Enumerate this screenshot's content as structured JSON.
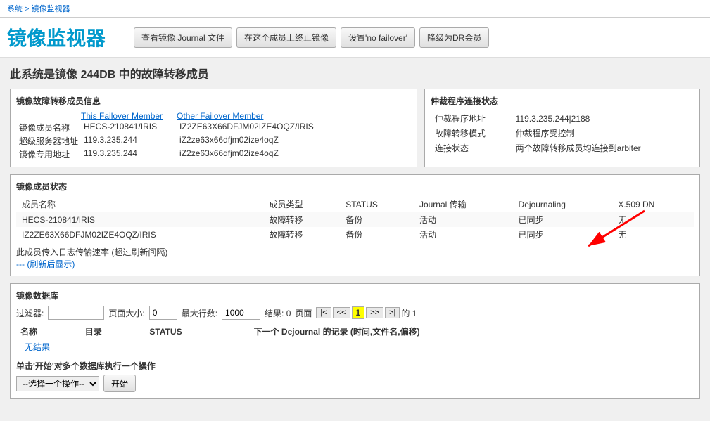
{
  "breadcrumb": {
    "system": "系统",
    "separator": " > ",
    "current": "镜像监视器"
  },
  "header": {
    "title": "镜像监视器",
    "buttons": {
      "view_journal": "查看镜像 Journal 文件",
      "stop_mirror": "在这个成员上终止镜像",
      "no_failover": "设置'no failover'",
      "dr_member": "降级为DR会员"
    }
  },
  "page_title": "此系统是镜像 244DB 中的故障转移成员",
  "failover_section": {
    "title": "镜像故障转移成员信息",
    "col_this": "This Failover Member",
    "col_other": "Other Failover Member",
    "rows": [
      {
        "label": "镜像成员名称",
        "this_value": "HECS-210841/IRIS",
        "other_value": "IZ2ZE63X66DFJM02IZE4OQZ/IRIS"
      },
      {
        "label": "超级服务器地址",
        "this_value": "119.3.235.244",
        "other_value": "iZ2ze63x66dfjm02ize4oqZ"
      },
      {
        "label": "镜像专用地址",
        "this_value": "119.3.235.244",
        "other_value": "iZ2ze63x66dfjm02ize4oqZ"
      }
    ]
  },
  "arbiter_section": {
    "title": "仲裁程序连接状态",
    "rows": [
      {
        "label": "仲裁程序地址",
        "value": "119.3.235.244|2188"
      },
      {
        "label": "故障转移模式",
        "value": "仲裁程序受控制"
      },
      {
        "label": "连接状态",
        "value": "两个故障转移成员均连接到arbiter"
      }
    ]
  },
  "member_status": {
    "title": "镜像成员状态",
    "columns": [
      "成员名称",
      "成员类型",
      "STATUS",
      "Journal 传输",
      "Dejournaling",
      "X.509 DN"
    ],
    "rows": [
      {
        "name": "HECS-210841/IRIS",
        "type": "故障转移",
        "role": "备份",
        "status": "活动",
        "journal": "已同步",
        "dejournal": "无"
      },
      {
        "name": "IZ2ZE63X66DFJM02IZE4OQZ/IRIS",
        "type": "故障转移",
        "role": "备份",
        "status": "活动",
        "journal": "已同步",
        "dejournal": "无"
      }
    ],
    "rate_text": "此成员传入日志传输速率 (超过刷新间隔)",
    "rate_link": "--- (刷新后显示)"
  },
  "db_section": {
    "title": "镜像数据库",
    "filter": {
      "label": "过滤器:",
      "filter_value": "",
      "page_size_label": "页面大小:",
      "page_size_value": "0",
      "max_rows_label": "最大行数:",
      "max_rows_value": "1000",
      "results_label": "结果: 0",
      "page_label": "页面",
      "current_page": "1",
      "total_pages": "的 1"
    },
    "columns": [
      "名称",
      "目录",
      "STATUS",
      "下一个 Dejournal 的记录 (时间,文件名,偏移)"
    ],
    "no_result": "无结果",
    "bulk_action": {
      "title": "单击'开始'对多个数据库执行一个操作",
      "select_label": "--选择一个操作--",
      "options": [
        "--选择一个操作--"
      ],
      "start_label": "开始"
    }
  }
}
